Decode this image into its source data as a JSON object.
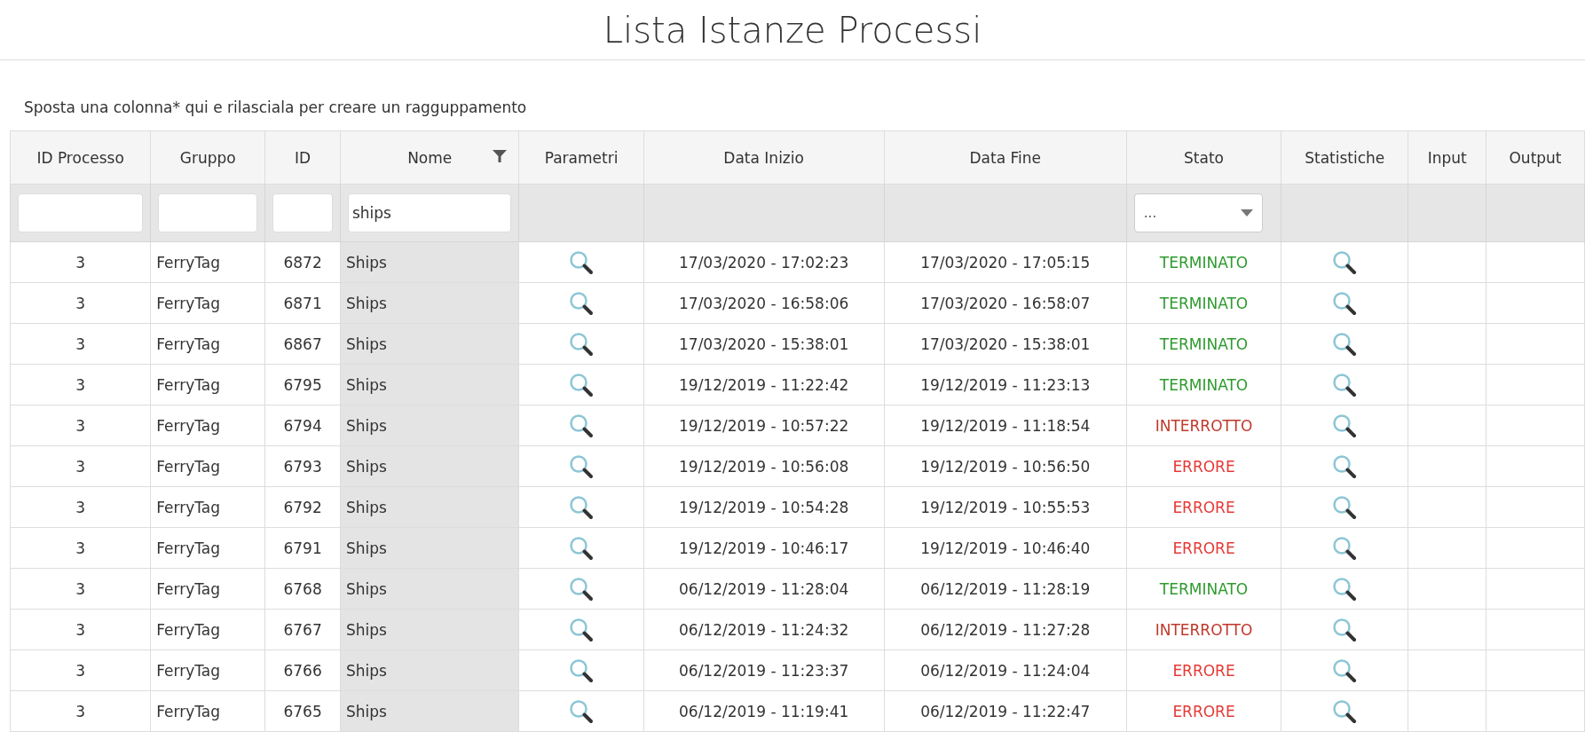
{
  "title": "Lista Istanze Processi",
  "group_hint": "Sposta una colonna* qui e rilasciala per creare un ragguppamento",
  "table": {
    "columns": [
      {
        "label": "ID Processo",
        "filter": {
          "kind": "text"
        }
      },
      {
        "label": "Gruppo",
        "filter": {
          "kind": "text"
        }
      },
      {
        "label": "ID",
        "filter": {
          "kind": "text"
        }
      },
      {
        "label": "Nome",
        "filtered": true,
        "filter": {
          "kind": "text",
          "value": "ships"
        }
      },
      {
        "label": "Parametri",
        "filter": {
          "kind": "none"
        }
      },
      {
        "label": "Data Inizio",
        "filter": {
          "kind": "none"
        }
      },
      {
        "label": "Data Fine",
        "filter": {
          "kind": "none"
        }
      },
      {
        "label": "Stato",
        "filter": {
          "kind": "select",
          "value": "..."
        }
      },
      {
        "label": "Statistiche",
        "filter": {
          "kind": "none"
        }
      },
      {
        "label": "Input",
        "filter": {
          "kind": "none"
        }
      },
      {
        "label": "Output",
        "filter": {
          "kind": "none"
        }
      }
    ],
    "rows": [
      {
        "id_processo": "3",
        "gruppo": "FerryTag",
        "id": "6872",
        "nome": "Ships",
        "data_inizio": "17/03/2020 - 17:02:23",
        "data_fine": "17/03/2020 - 17:05:15",
        "stato": {
          "text": "TERMINATO",
          "kind": "done"
        }
      },
      {
        "id_processo": "3",
        "gruppo": "FerryTag",
        "id": "6871",
        "nome": "Ships",
        "data_inizio": "17/03/2020 - 16:58:06",
        "data_fine": "17/03/2020 - 16:58:07",
        "stato": {
          "text": "TERMINATO",
          "kind": "done"
        }
      },
      {
        "id_processo": "3",
        "gruppo": "FerryTag",
        "id": "6867",
        "nome": "Ships",
        "data_inizio": "17/03/2020 - 15:38:01",
        "data_fine": "17/03/2020 - 15:38:01",
        "stato": {
          "text": "TERMINATO",
          "kind": "done"
        }
      },
      {
        "id_processo": "3",
        "gruppo": "FerryTag",
        "id": "6795",
        "nome": "Ships",
        "data_inizio": "19/12/2019 - 11:22:42",
        "data_fine": "19/12/2019 - 11:23:13",
        "stato": {
          "text": "TERMINATO",
          "kind": "done"
        }
      },
      {
        "id_processo": "3",
        "gruppo": "FerryTag",
        "id": "6794",
        "nome": "Ships",
        "data_inizio": "19/12/2019 - 10:57:22",
        "data_fine": "19/12/2019 - 11:18:54",
        "stato": {
          "text": "INTERROTTO",
          "kind": "interrupted"
        }
      },
      {
        "id_processo": "3",
        "gruppo": "FerryTag",
        "id": "6793",
        "nome": "Ships",
        "data_inizio": "19/12/2019 - 10:56:08",
        "data_fine": "19/12/2019 - 10:56:50",
        "stato": {
          "text": "ERRORE",
          "kind": "error"
        }
      },
      {
        "id_processo": "3",
        "gruppo": "FerryTag",
        "id": "6792",
        "nome": "Ships",
        "data_inizio": "19/12/2019 - 10:54:28",
        "data_fine": "19/12/2019 - 10:55:53",
        "stato": {
          "text": "ERRORE",
          "kind": "error"
        }
      },
      {
        "id_processo": "3",
        "gruppo": "FerryTag",
        "id": "6791",
        "nome": "Ships",
        "data_inizio": "19/12/2019 - 10:46:17",
        "data_fine": "19/12/2019 - 10:46:40",
        "stato": {
          "text": "ERRORE",
          "kind": "error"
        }
      },
      {
        "id_processo": "3",
        "gruppo": "FerryTag",
        "id": "6768",
        "nome": "Ships",
        "data_inizio": "06/12/2019 - 11:28:04",
        "data_fine": "06/12/2019 - 11:28:19",
        "stato": {
          "text": "TERMINATO",
          "kind": "done"
        }
      },
      {
        "id_processo": "3",
        "gruppo": "FerryTag",
        "id": "6767",
        "nome": "Ships",
        "data_inizio": "06/12/2019 - 11:24:32",
        "data_fine": "06/12/2019 - 11:27:28",
        "stato": {
          "text": "INTERROTTO",
          "kind": "interrupted"
        }
      },
      {
        "id_processo": "3",
        "gruppo": "FerryTag",
        "id": "6766",
        "nome": "Ships",
        "data_inizio": "06/12/2019 - 11:23:37",
        "data_fine": "06/12/2019 - 11:24:04",
        "stato": {
          "text": "ERRORE",
          "kind": "error"
        }
      },
      {
        "id_processo": "3",
        "gruppo": "FerryTag",
        "id": "6765",
        "nome": "Ships",
        "data_inizio": "06/12/2019 - 11:19:41",
        "data_fine": "06/12/2019 - 11:22:47",
        "stato": {
          "text": "ERRORE",
          "kind": "error"
        }
      }
    ]
  }
}
